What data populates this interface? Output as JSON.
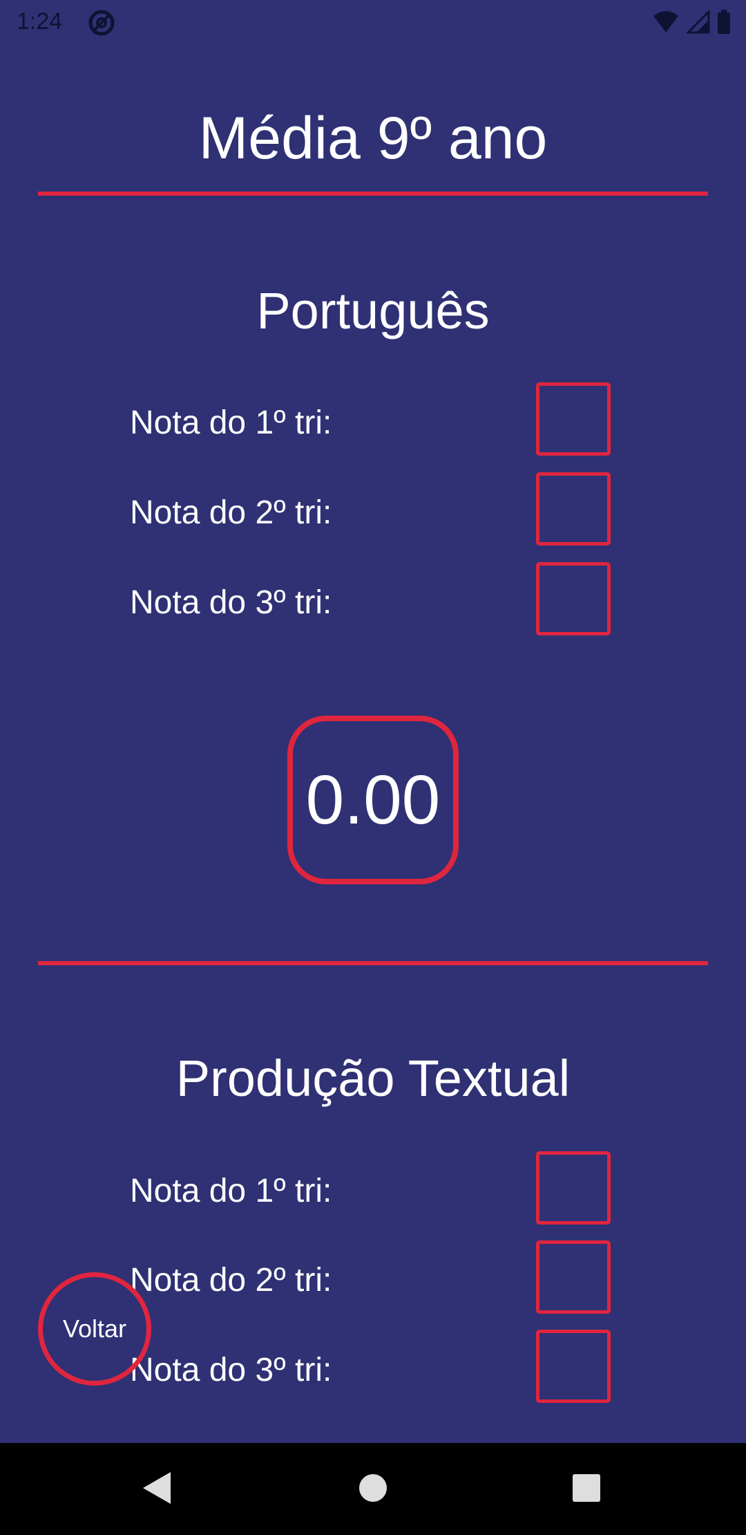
{
  "status_bar": {
    "time": "1:24",
    "icons": [
      "app-notification-icon",
      "wifi-icon",
      "cellular-signal-icon",
      "battery-icon"
    ]
  },
  "page": {
    "title": "Média 9º ano"
  },
  "sections": [
    {
      "title": "Português",
      "rows": [
        {
          "label": "Nota do 1º tri:",
          "value": ""
        },
        {
          "label": "Nota do 2º tri:",
          "value": ""
        },
        {
          "label": "Nota do 3º tri:",
          "value": ""
        }
      ],
      "average": "0.00"
    },
    {
      "title": "Produção Textual",
      "rows": [
        {
          "label": "Nota do 1º tri:",
          "value": ""
        },
        {
          "label": "Nota do 2º tri:",
          "value": ""
        },
        {
          "label": "Nota do 3º tri:",
          "value": ""
        }
      ]
    }
  ],
  "back_button": {
    "label": "Voltar"
  },
  "nav_bar": {
    "buttons": [
      "back-triangle-icon",
      "home-circle-icon",
      "recents-square-icon"
    ]
  },
  "colors": {
    "background": "#2f3174",
    "accent": "#e0253f",
    "text": "#ffffff"
  }
}
